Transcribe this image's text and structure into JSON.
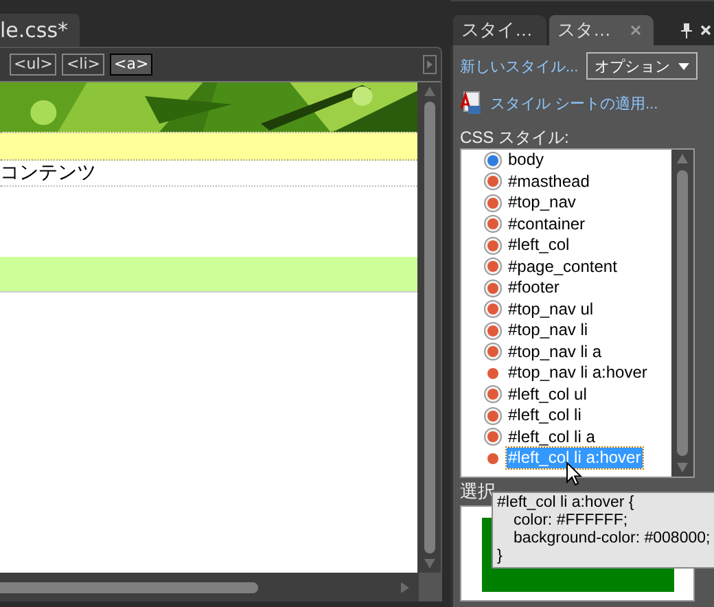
{
  "document_tab": {
    "label": "le.css*"
  },
  "tag_selector": [
    {
      "label": "<ul>",
      "selected": false
    },
    {
      "label": "<li>",
      "selected": false
    },
    {
      "label": "<a>",
      "selected": true
    }
  ],
  "design_view": {
    "content_text": "コンテンツ"
  },
  "panel": {
    "tabs": [
      {
        "label": "スタイ…",
        "selected": false
      },
      {
        "label": "スタ…",
        "selected": true
      }
    ],
    "new_style_link": "新しいスタイル...",
    "options_button": "オプション",
    "attach_link": "スタイル シートの適用...",
    "list_label": "CSS スタイル:",
    "styles": [
      {
        "name": "body",
        "kind": "element",
        "selected": false
      },
      {
        "name": "#masthead",
        "kind": "id",
        "selected": false
      },
      {
        "name": "#top_nav",
        "kind": "id",
        "selected": false
      },
      {
        "name": "#container",
        "kind": "id",
        "selected": false
      },
      {
        "name": "#left_col",
        "kind": "id",
        "selected": false
      },
      {
        "name": "#page_content",
        "kind": "id",
        "selected": false
      },
      {
        "name": "#footer",
        "kind": "id",
        "selected": false
      },
      {
        "name": "#top_nav ul",
        "kind": "id",
        "selected": false
      },
      {
        "name": "#top_nav li",
        "kind": "id",
        "selected": false
      },
      {
        "name": "#top_nav li a",
        "kind": "id",
        "selected": false
      },
      {
        "name": "#top_nav li a:hover",
        "kind": "pseudo",
        "selected": false
      },
      {
        "name": "#left_col ul",
        "kind": "id",
        "selected": false
      },
      {
        "name": "#left_col li",
        "kind": "id",
        "selected": false
      },
      {
        "name": "#left_col li a",
        "kind": "id",
        "selected": false
      },
      {
        "name": "#left_col li a:hover",
        "kind": "pseudo",
        "selected": true
      }
    ],
    "preview_label": "選択",
    "tooltip": [
      "#left_col li a:hover {",
      "color: #FFFFFF;",
      "background-color: #008000;",
      "}"
    ]
  }
}
